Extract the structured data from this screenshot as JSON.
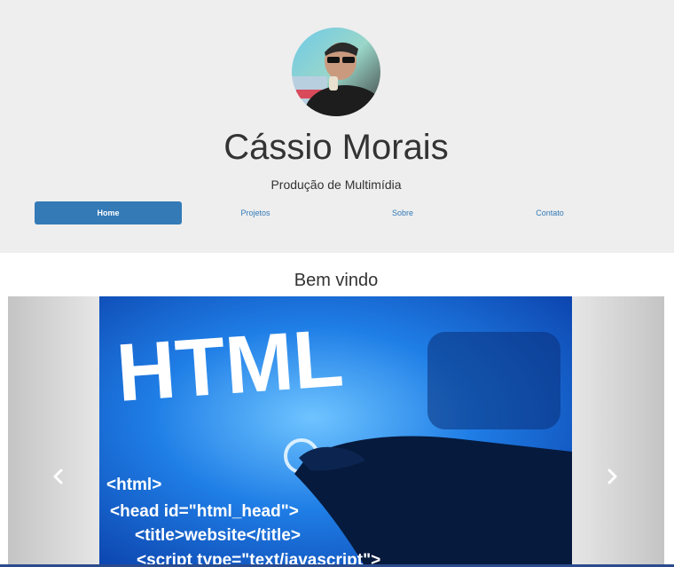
{
  "profile": {
    "name": "Cássio Morais",
    "subtitle": "Produção de Multimídia"
  },
  "nav": {
    "items": [
      {
        "label": "Home",
        "active": true
      },
      {
        "label": "Projetos",
        "active": false
      },
      {
        "label": "Sobre",
        "active": false
      },
      {
        "label": "Contato",
        "active": false
      }
    ]
  },
  "main": {
    "heading": "Bem vindo"
  },
  "carousel": {
    "slide_text": {
      "big": "HTML",
      "code_lines": [
        "<html>",
        "<head id=\"html_head\">",
        "<title>website</title>",
        "<script type=\"text/javascript\">"
      ]
    },
    "prev_icon": "chevron-left-icon",
    "next_icon": "chevron-right-icon"
  },
  "colors": {
    "header_bg": "#eeeeee",
    "accent": "#337ab7",
    "slide_blue": "#1f7ee6"
  }
}
